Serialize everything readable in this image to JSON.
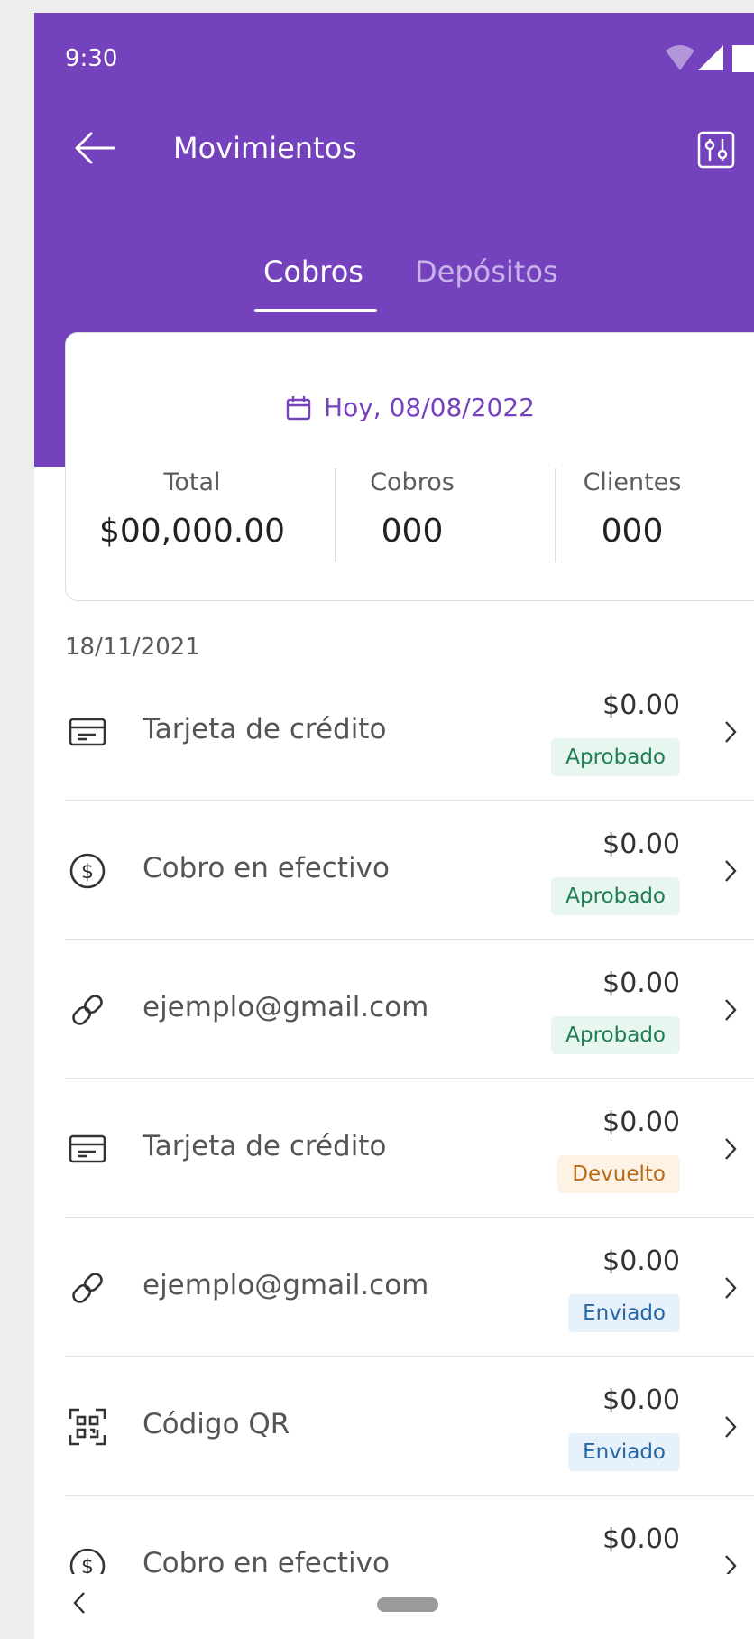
{
  "status_bar": {
    "time": "9:30",
    "icons": [
      "wifi-icon",
      "signal-icon",
      "battery-icon"
    ]
  },
  "header": {
    "title": "Movimientos",
    "back_icon": "arrow-left-icon",
    "filter_icon": "filter-sliders-icon"
  },
  "tabs": [
    {
      "label": "Cobros",
      "active": true
    },
    {
      "label": "Depósitos",
      "active": false
    }
  ],
  "summary": {
    "date_label": "Hoy, 08/08/2022",
    "stats": [
      {
        "label": "Total",
        "value": "$00,000.00"
      },
      {
        "label": "Cobros",
        "value": "000"
      },
      {
        "label": "Clientes",
        "value": "000"
      }
    ]
  },
  "list": {
    "group_date": "18/11/2021",
    "items": [
      {
        "icon": "credit-card-icon",
        "label": "Tarjeta de crédito",
        "amount": "$0.00",
        "status": "Aprobado",
        "status_type": "ok"
      },
      {
        "icon": "dollar-circle-icon",
        "label": "Cobro en efectivo",
        "amount": "$0.00",
        "status": "Aprobado",
        "status_type": "ok"
      },
      {
        "icon": "link-icon",
        "label": "ejemplo@gmail.com",
        "amount": "$0.00",
        "status": "Aprobado",
        "status_type": "ok"
      },
      {
        "icon": "credit-card-icon",
        "label": "Tarjeta de crédito",
        "amount": "$0.00",
        "status": "Devuelto",
        "status_type": "ret"
      },
      {
        "icon": "link-icon",
        "label": "ejemplo@gmail.com",
        "amount": "$0.00",
        "status": "Enviado",
        "status_type": "sent"
      },
      {
        "icon": "qr-code-icon",
        "label": "Código QR",
        "amount": "$0.00",
        "status": "Enviado",
        "status_type": "sent"
      },
      {
        "icon": "dollar-circle-icon",
        "label": "Cobro en efectivo",
        "amount": "$0.00",
        "status": "",
        "status_type": ""
      }
    ]
  },
  "colors": {
    "brand_purple": "#7442bc",
    "approved": "#1f7f52",
    "returned": "#b86a16",
    "sent": "#2467a9"
  }
}
